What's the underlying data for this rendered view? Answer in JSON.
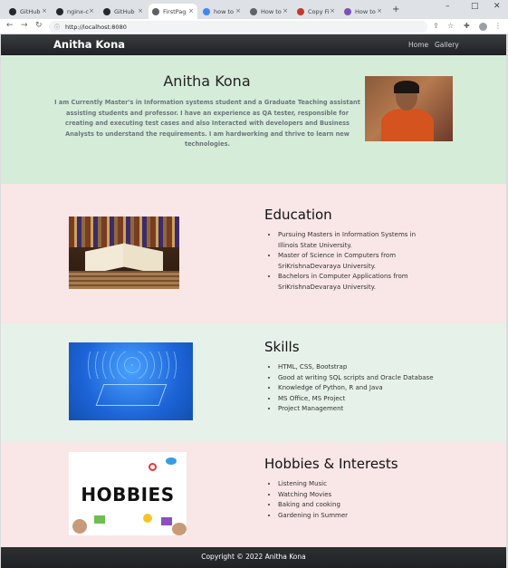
{
  "browser": {
    "tabs": [
      {
        "title": "GitHub",
        "favicon": "github-icon",
        "active": false
      },
      {
        "title": "nginx-c",
        "favicon": "github-icon",
        "active": false
      },
      {
        "title": "GitHub",
        "favicon": "github-icon",
        "active": false
      },
      {
        "title": "FirstPag",
        "favicon": "globe-icon",
        "active": true
      },
      {
        "title": "how to",
        "favicon": "google-icon",
        "active": false
      },
      {
        "title": "How to",
        "favicon": "globe-icon",
        "active": false
      },
      {
        "title": "Copy Fi",
        "favicon": "copy-icon",
        "active": false
      },
      {
        "title": "How to",
        "favicon": "bootstrap-icon",
        "active": false
      }
    ],
    "close_glyph": "×",
    "new_tab_glyph": "+",
    "window_controls": {
      "minimize": "–",
      "maximize": "□",
      "close": "✕"
    },
    "nav": {
      "back": "←",
      "forward": "→",
      "reload": "↻"
    },
    "address": "http://localhost:8080",
    "address_info_glyph": "ⓘ"
  },
  "site": {
    "brand": "Anitha Kona",
    "nav_links": [
      "Home",
      "Gallery"
    ],
    "hero": {
      "name": "Anitha Kona",
      "bio": "I am Currently Master's in Information systems student and a Graduate Teaching assistant assisting students and professor. I have an experience as QA tester, responsible for creating and executing test cases and also Interacted with developers and Business Analysts to understand the requirements. I am hardworking and thrive to learn new technologies."
    },
    "education": {
      "heading": "Education",
      "items": [
        "Pursuing Masters in Information Systems in Illinois State University.",
        "Master of Science in Computers from SriKrishnaDevaraya University.",
        "Bachelors in Computer Applications from SriKrishnaDevaraya University."
      ]
    },
    "skills": {
      "heading": "Skills",
      "items": [
        "HTML, CSS, Bootstrap",
        "Good at writing SQL scripts and Oracle Database",
        "Knowledge of Python, R and Java",
        "MS Office, MS Project",
        "Project Management"
      ]
    },
    "hobbies": {
      "heading": "Hobbies & Interests",
      "image_text": "HOBBIES",
      "items": [
        "Listening Music",
        "Watching Movies",
        "Baking and cooking",
        "Gardening in Summer"
      ]
    },
    "footer": "Copyright © 2022 Anitha Kona"
  },
  "colors": {
    "navbar": "#2b2d30",
    "hero_bg": "#d5ecd9",
    "pink_bg": "#f9e6e6",
    "skills_bg": "#e6f1ea",
    "footer": "#1f2124"
  }
}
